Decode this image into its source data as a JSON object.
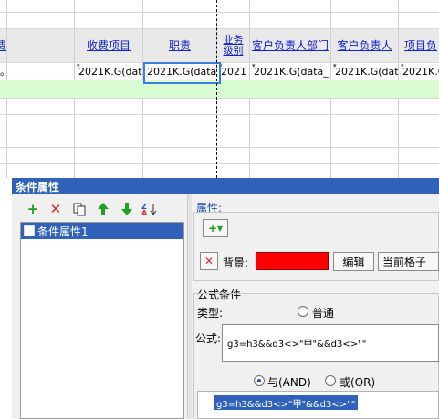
{
  "sheet": {
    "left_header_partial": "费",
    "columns": [
      {
        "label": "收费项目"
      },
      {
        "label": "职责"
      },
      {
        "label": "业务\n级别"
      },
      {
        "label": "客户负责人部门"
      },
      {
        "label": "客户负责人"
      },
      {
        "label": "项目负"
      }
    ],
    "row1": {
      "partial": "。",
      "cells": [
        "2021K.G(dat",
        "2021K.G(data_",
        "2021",
        "2021K.G(data_",
        "2021K.G(dat",
        "2021K.G"
      ]
    },
    "colors": {
      "header_bg": "#e9e9e9",
      "green_row": "#d9fbd2",
      "selection": "#3c7be0"
    }
  },
  "dialog": {
    "title": "条件属性",
    "toolbar_icons": [
      "add-icon",
      "delete-icon",
      "copy-icon",
      "move-up-icon",
      "move-down-icon",
      "sort-icon"
    ],
    "tree_item": "条件属性1",
    "properties": {
      "section_label": "属性:",
      "add_dropdown_glyph": "+▾",
      "background_label": "背景:",
      "background_color": "#ff0000",
      "edit_button": "编辑",
      "scope_select": "当前格子"
    },
    "formula": {
      "group_label": "公式条件",
      "type_label": "类型:",
      "type_option": "普通",
      "formula_label": "公式:",
      "formula_value": "g3=h3&&d3<>\"甲\"&&d3<>\"\"",
      "and_label": "与(AND)",
      "or_label": "或(OR)",
      "tree_value": "g3=h3&&d3<>\"甲\"&&d3<>\"\""
    }
  }
}
